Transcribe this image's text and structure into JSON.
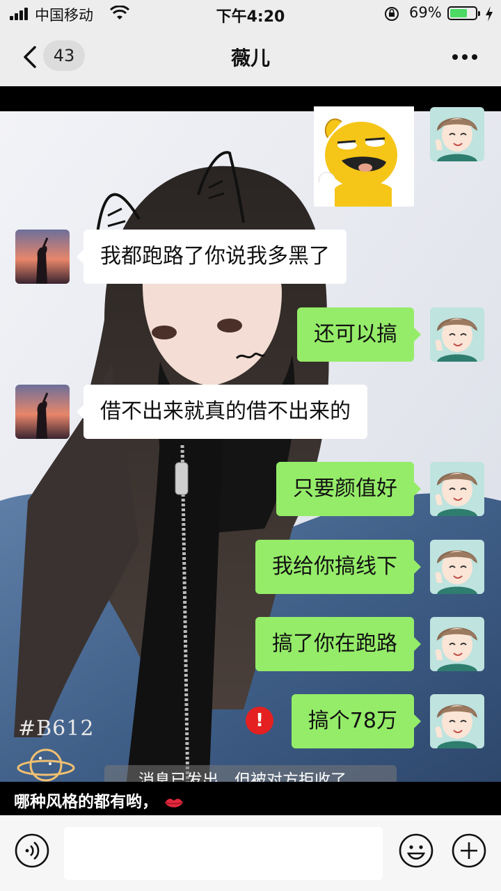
{
  "status_bar": {
    "carrier": "中国移动",
    "time": "下午4:20",
    "battery_percent": "69%",
    "battery_level": 0.69,
    "icons": [
      "signal-icon",
      "wifi-icon",
      "rotation-lock-icon",
      "battery-icon",
      "charging-icon"
    ]
  },
  "nav": {
    "unread_count": "43",
    "title": "薇儿",
    "icons": [
      "back-chevron-icon",
      "more-dots-icon"
    ]
  },
  "messages": [
    {
      "side": "out",
      "type": "sticker",
      "sticker": "yellow-duck-sticker"
    },
    {
      "side": "in",
      "text": "我都跑路了你说我多黑了"
    },
    {
      "side": "out",
      "text": "还可以搞"
    },
    {
      "side": "in",
      "text": "借不出来就真的借不出来的"
    },
    {
      "side": "out",
      "text": "只要颜值好"
    },
    {
      "side": "out",
      "text": "我给你搞线下"
    },
    {
      "side": "out",
      "text": "搞了你在跑路"
    },
    {
      "side": "out",
      "text": "搞个78万",
      "failed": true,
      "error_mark": "!"
    }
  ],
  "system_notice": "消息已发出，但被对方拒收了。",
  "background_caption": "哪种风格的都有哟，",
  "background_watermark": "#B612",
  "input_bar": {
    "text_value": "",
    "icons": [
      "voice-icon",
      "emoji-icon",
      "plus-icon"
    ]
  },
  "colors": {
    "outgoing_bubble": "#95ec69",
    "incoming_bubble": "#ffffff",
    "bar_background": "#ededed",
    "error": "#e52020"
  }
}
